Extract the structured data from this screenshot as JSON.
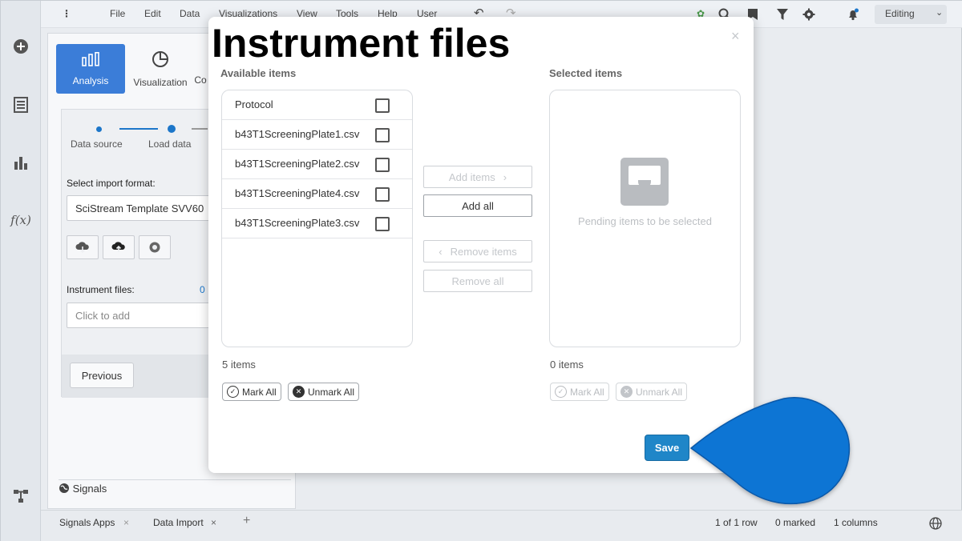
{
  "menubar": {
    "items": [
      "File",
      "Edit",
      "Data",
      "Visualizations",
      "View",
      "Tools",
      "Help",
      "User"
    ],
    "mode": "Editing"
  },
  "panel": {
    "tabs": [
      {
        "label": "Analysis",
        "icon": "analysis-icon",
        "active": true
      },
      {
        "label": "Visualization",
        "icon": "pie-chart-icon",
        "active": false
      },
      {
        "label": "Co",
        "icon": "",
        "active": false
      }
    ],
    "steps": [
      "Data source",
      "Load data"
    ],
    "import_format_label": "Select import format:",
    "import_format_value": "SciStream Template SVV60",
    "instrument_files_label": "Instrument files:",
    "instrument_files_count": "0",
    "instrument_files_placeholder": "Click to add",
    "previous_label": "Previous",
    "signals_label": "Signals"
  },
  "bottombar": {
    "tabs": [
      "Signals Apps",
      "Data Import"
    ],
    "rows_status": "1 of 1 row",
    "marked_status": "0 marked",
    "columns_status": "1 columns"
  },
  "modal": {
    "title": "Instrument files",
    "available_heading": "Available items",
    "selected_heading": "Selected items",
    "available_items": [
      "Protocol",
      "b43T1ScreeningPlate1.csv",
      "b43T1ScreeningPlate2.csv",
      "b43T1ScreeningPlate4.csv",
      "b43T1ScreeningPlate3.csv"
    ],
    "add_items_label": "Add items",
    "add_all_label": "Add all",
    "remove_items_label": "Remove items",
    "remove_all_label": "Remove all",
    "empty_text": "Pending items to be selected",
    "available_count": "5 items",
    "selected_count": "0 items",
    "mark_all_label": "Mark All",
    "unmark_all_label": "Unmark All",
    "save_label": "Save",
    "close_glyph": "×"
  },
  "colors": {
    "accent": "#1f86c8",
    "callout": "#0a74d4",
    "active_tab": "#3b7dd8"
  }
}
